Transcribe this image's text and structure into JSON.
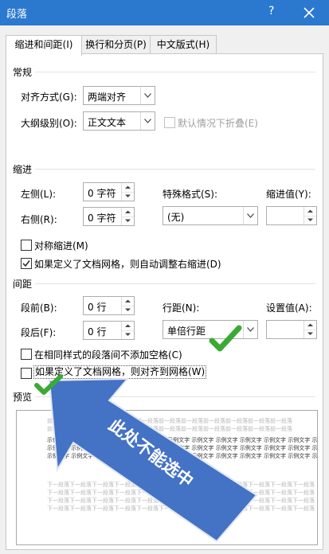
{
  "window": {
    "title": "段落",
    "help": "?"
  },
  "tabs": [
    {
      "label": "缩进和间距(I)",
      "active": true
    },
    {
      "label": "换行和分页(P)",
      "active": false
    },
    {
      "label": "中文版式(H)",
      "active": false
    }
  ],
  "general": {
    "header": "常规",
    "alignment_label": "对齐方式(G):",
    "alignment_value": "两端对齐",
    "outline_label": "大纲级别(O):",
    "outline_value": "正文文本",
    "collapse_label": "默认情况下折叠(E)",
    "collapse_checked": false
  },
  "indent": {
    "header": "缩进",
    "left_label": "左侧(L):",
    "left_value": "0 字符",
    "right_label": "右侧(R):",
    "right_value": "0 字符",
    "special_label": "特殊格式(S):",
    "special_value": "(无)",
    "by_label": "缩进值(Y):",
    "by_value": "",
    "mirror_label": "对称缩进(M)",
    "mirror_checked": false,
    "grid_label": "如果定义了文档网格，则自动调整右缩进(D)",
    "grid_checked": true
  },
  "spacing": {
    "header": "间距",
    "before_label": "段前(B):",
    "before_value": "0 行",
    "after_label": "段后(F):",
    "after_value": "0 行",
    "line_label": "行距(N):",
    "line_value": "单倍行距",
    "at_label": "设置值(A):",
    "at_value": "",
    "no_space_label": "在相同样式的段落间不添加空格(C)",
    "no_space_checked": false,
    "snap_label": "如果定义了文档网格，则对齐到网格(W)",
    "snap_checked": false
  },
  "preview": {
    "header": "预览",
    "prev_text": "前一段落前一段落前一段落前一段落前一段落前一段落前一段落前一段落前一段落前一段落前一段落",
    "sample_text": "示例文字 示例文字 示例文字 示例文字 示例文字 示例文字 示例文字 示例文字 示例文字 示例文字 示例文字 示例文字 示例文字 示例文字 示例文字",
    "next_text": "下一段落下一段落下一段落下一段落下一段落下一段落下一段落下一段落下一段落下一段落下一段落下一段落"
  },
  "annotation": {
    "text": "此处不能选中",
    "arrow_color": "#4472c4",
    "check_color": "#3aaa35"
  },
  "colors": {
    "titlebar": "#2b78cf",
    "panel": "#ffffff",
    "dialog_bg": "#f0f0f0"
  }
}
